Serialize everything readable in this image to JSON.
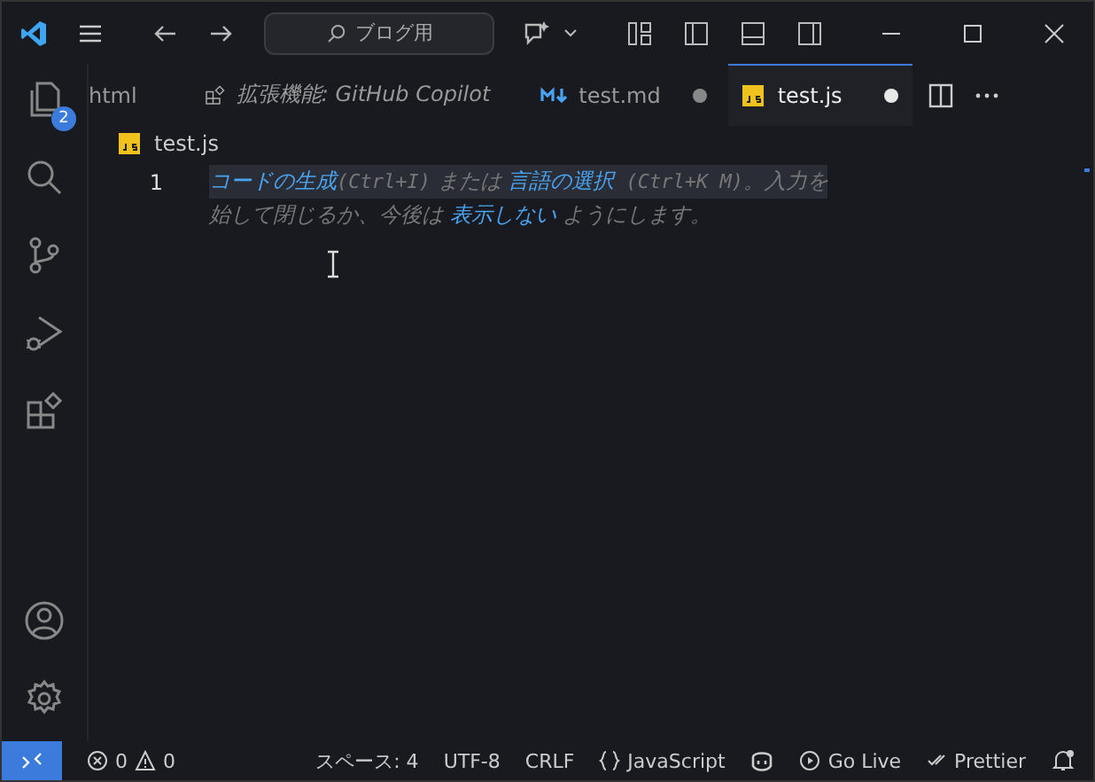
{
  "title_bar": {
    "search": "ブログ用"
  },
  "activity_bar": {
    "explorer_badge": "2"
  },
  "tabs": [
    {
      "label": "html",
      "kind": "plain",
      "selected": false,
      "dirty": false,
      "italic": false
    },
    {
      "label": "拡張機能: GitHub Copilot",
      "kind": "extension",
      "selected": false,
      "dirty": false,
      "italic": true
    },
    {
      "label": "test.md",
      "kind": "markdown",
      "selected": false,
      "dirty": true,
      "italic": false
    },
    {
      "label": "test.js",
      "kind": "javascript",
      "selected": true,
      "dirty": true,
      "italic": false
    }
  ],
  "breadcrumb": "test.js",
  "editor": {
    "line_number": "1",
    "hint_lines": [
      [
        {
          "kind": "link",
          "text": "コードの生成"
        },
        {
          "kind": "code",
          "text": "(Ctrl+I)"
        },
        {
          "kind": "text",
          "text": " または "
        },
        {
          "kind": "link",
          "text": "言語の選択"
        },
        {
          "kind": "code",
          "text": " (Ctrl+K M)"
        },
        {
          "kind": "text",
          "text": "。入力を"
        }
      ],
      [
        {
          "kind": "text",
          "text": "始して閉じるか、今後は "
        },
        {
          "kind": "link",
          "text": "表示しない"
        },
        {
          "kind": "text",
          "text": " ようにします。"
        }
      ]
    ]
  },
  "status_bar": {
    "errors": "0",
    "warnings": "0",
    "indent": "スペース: 4",
    "encoding": "UTF-8",
    "eol": "CRLF",
    "language": "JavaScript",
    "go_live": "Go Live",
    "prettier": "Prettier"
  }
}
